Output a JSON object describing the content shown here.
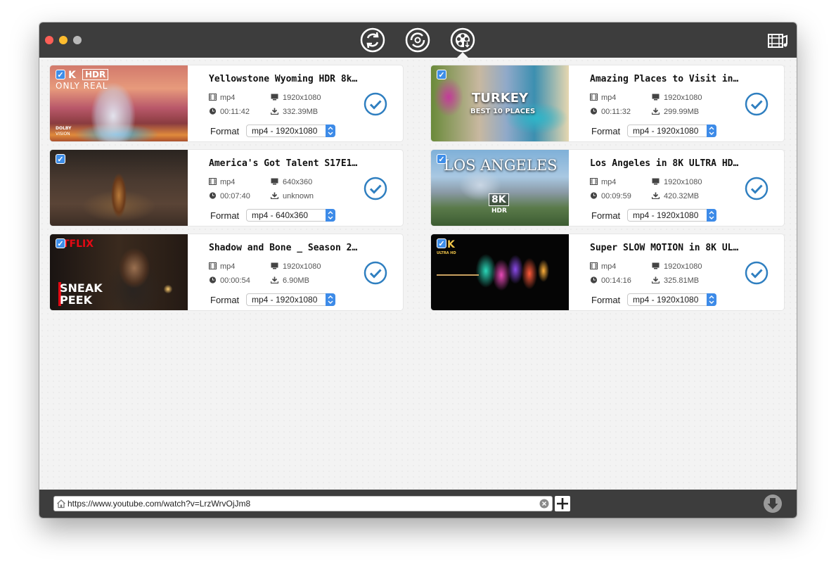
{
  "window": {
    "modes": [
      "convert-icon",
      "sync-icon",
      "video-download-icon"
    ],
    "active_mode": "video-download-icon"
  },
  "format_label": "Format",
  "thumb_badges": {
    "hdr_top": "K",
    "hdr_box": "HDR",
    "only_real": "ONLY REAL",
    "dolby_line1": "DOLBY",
    "dolby_line2": "VISION",
    "turkey": "TURKEY",
    "best10": "BEST 10 PLACES",
    "los_angeles": "LOS ANGELES",
    "la_8k": "8K",
    "la_hdr": "HDR",
    "netflix": "TFLIX",
    "sneak1": "SNEAK",
    "sneak2": "PEEK",
    "uhd_k": "K",
    "uhd_line": "ULTRA HD"
  },
  "videos": [
    {
      "title": "Yellowstone Wyoming HDR 8k…",
      "container": "mp4",
      "resolution": "1920x1080",
      "duration": "00:11:42",
      "size": "332.39MB",
      "format": "mp4 - 1920x1080"
    },
    {
      "title": "Amazing Places to Visit in…",
      "container": "mp4",
      "resolution": "1920x1080",
      "duration": "00:11:32",
      "size": "299.99MB",
      "format": "mp4 - 1920x1080"
    },
    {
      "title": "America's Got Talent S17E1…",
      "container": "mp4",
      "resolution": "640x360",
      "duration": "00:07:40",
      "size": "unknown",
      "format": "mp4 - 640x360"
    },
    {
      "title": "Los Angeles in 8K ULTRA HD…",
      "container": "mp4",
      "resolution": "1920x1080",
      "duration": "00:09:59",
      "size": "420.32MB",
      "format": "mp4 - 1920x1080"
    },
    {
      "title": "Shadow and Bone _ Season 2…",
      "container": "mp4",
      "resolution": "1920x1080",
      "duration": "00:00:54",
      "size": "6.90MB",
      "format": "mp4 - 1920x1080"
    },
    {
      "title": "Super SLOW MOTION in 8K UL…",
      "container": "mp4",
      "resolution": "1920x1080",
      "duration": "00:14:16",
      "size": "325.81MB",
      "format": "mp4 - 1920x1080"
    }
  ],
  "url_bar": {
    "value": "https://www.youtube.com/watch?v=LrzWrvOjJm8"
  },
  "colors": {
    "titlebar": "#3d3d3d",
    "accent": "#2f7fc0",
    "checkbox": "#3f8ee8"
  }
}
